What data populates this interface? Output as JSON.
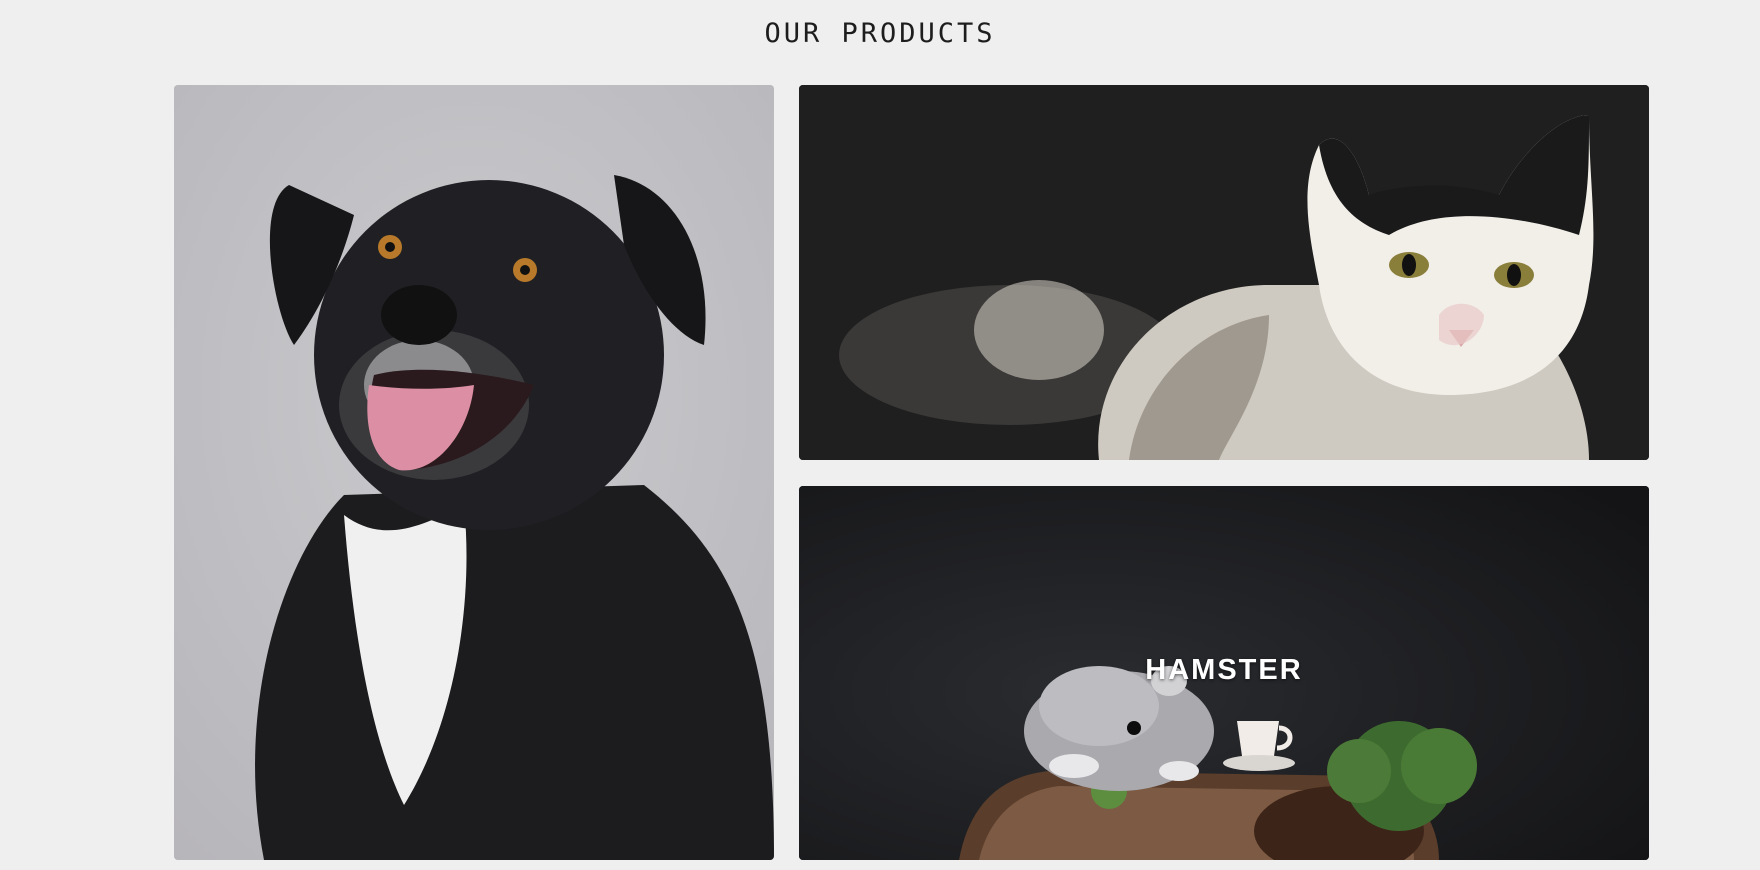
{
  "section": {
    "title": "OUR PRODUCTS"
  },
  "products": [
    {
      "name": "dog",
      "caption": ""
    },
    {
      "name": "cat",
      "caption": ""
    },
    {
      "name": "hamster",
      "caption": "HAMSTER"
    }
  ],
  "colors": {
    "page_background": "#efefef",
    "title_text": "#1d1d1d",
    "caption_text": "#ffffff",
    "dog_backdrop": "#c1c0c4",
    "cat_backdrop": "#1e1e1e",
    "hamster_backdrop": "#19191b"
  }
}
